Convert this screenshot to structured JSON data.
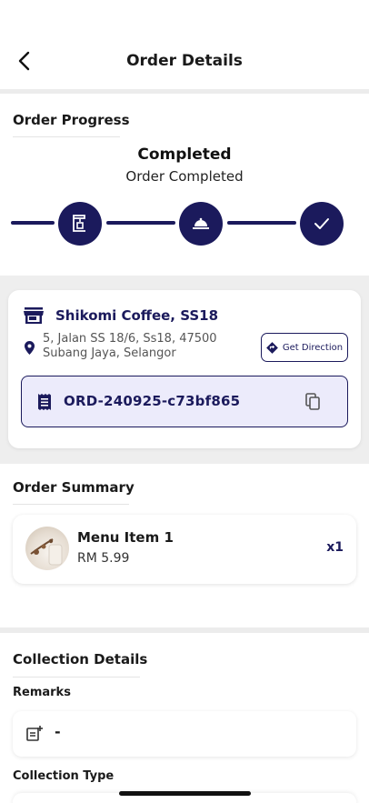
{
  "header": {
    "title": "Order Details"
  },
  "progress": {
    "section_title": "Order Progress",
    "status": "Completed",
    "status_detail": "Order Completed",
    "steps": [
      {
        "icon": "coffee-machine-icon",
        "state": "done"
      },
      {
        "icon": "food-tray-icon",
        "state": "done"
      },
      {
        "icon": "check-icon",
        "state": "done"
      }
    ]
  },
  "store": {
    "name": "Shikomi Coffee, SS18",
    "address_line1": "5, Jalan SS 18/6, Ss18, 47500",
    "address_line2": "Subang Jaya, Selangor",
    "direction_label": "Get Direction",
    "order_id": "ORD-240925-c73bf865"
  },
  "summary": {
    "section_title": "Order Summary",
    "items": [
      {
        "name": "Menu Item 1",
        "price": "RM 5.99",
        "qty": "x1"
      }
    ]
  },
  "collection": {
    "section_title": "Collection Details",
    "remarks_label": "Remarks",
    "remarks_value": "-",
    "type_label": "Collection Type"
  },
  "colors": {
    "primary": "#1b1a5c",
    "order_box_bg": "#ecebfb",
    "band": "#eeeeee"
  }
}
